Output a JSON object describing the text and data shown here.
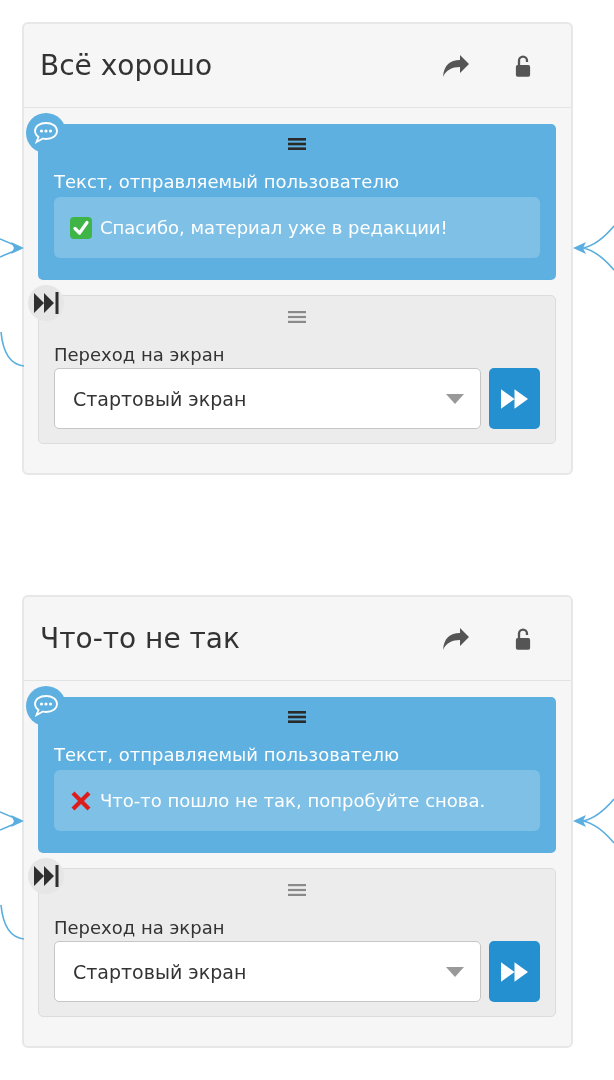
{
  "cards": [
    {
      "title": "Всё хорошо",
      "locked": false,
      "message": {
        "label": "Текст, отправляемый пользователю",
        "kind": "success",
        "text": "Спасибо, материал уже в редакции!"
      },
      "transition": {
        "label": "Переход на экран",
        "value": "Стартовый экран"
      }
    },
    {
      "title": "Что-то не так",
      "locked": false,
      "message": {
        "label": "Текст, отправляемый пользователю",
        "kind": "error",
        "text": "Что-то пошло не так, попробуйте снова."
      },
      "transition": {
        "label": "Переход на экран",
        "value": "Стартовый экран"
      }
    }
  ]
}
